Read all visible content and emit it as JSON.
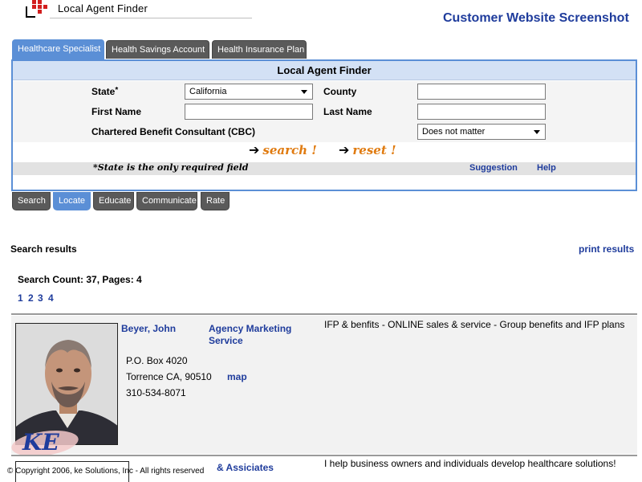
{
  "header": {
    "app_title": "Local Agent Finder",
    "right_title": "Customer Website Screenshot"
  },
  "tabs": [
    {
      "label": "Healthcare Specialist",
      "active": true
    },
    {
      "label": "Health Savings Account",
      "active": false
    },
    {
      "label": "Health Insurance Plan",
      "active": false
    }
  ],
  "panel": {
    "title": "Local Agent Finder",
    "state_label": "State",
    "state_required_mark": "*",
    "state_value": "California",
    "county_label": "County",
    "county_value": "",
    "first_name_label": "First Name",
    "first_name_value": "",
    "last_name_label": "Last Name",
    "last_name_value": "",
    "cbc_label": "Chartered Benefit Consultant (CBC)",
    "cbc_value": "Does not matter",
    "search_label": "search !",
    "reset_label": "reset !",
    "required_note": "*State is the only required field",
    "suggestion_label": "Suggestion",
    "help_label": "Help"
  },
  "nav_buttons": [
    {
      "label": "Search",
      "active": false
    },
    {
      "label": "Locate",
      "active": true
    },
    {
      "label": "Educate",
      "active": false
    },
    {
      "label": "Communicate",
      "active": false
    },
    {
      "label": "Rate",
      "active": false
    }
  ],
  "results": {
    "label": "Search results",
    "print_label": "print results",
    "count_text": "Search Count: 37, Pages: 4",
    "pages": [
      "1",
      "2",
      "3",
      "4"
    ],
    "items": [
      {
        "name": "Beyer, John",
        "agency": "Agency Marketing Service",
        "description": "IFP & benfits - ONLINE sales & service - Group benefits and IFP plans",
        "address_line1": "P.O. Box 4020",
        "address_line2": "Torrence CA, 90510",
        "map_label": "map",
        "phone": "310-534-8071"
      },
      {
        "agency": "& Assiciates",
        "description": "I help business owners and individuals develop healthcare solutions!"
      }
    ]
  },
  "footer": {
    "copyright": "© Copyright 2006, ke Solutions, Inc - All rights reserved",
    "logo_text": "KE"
  },
  "colors": {
    "accent_blue": "#5b8fd6",
    "link_blue": "#1f3c9c",
    "tab_gray": "#5a5a5a",
    "action_orange": "#e07b10",
    "logo_red": "#d21f1f"
  }
}
